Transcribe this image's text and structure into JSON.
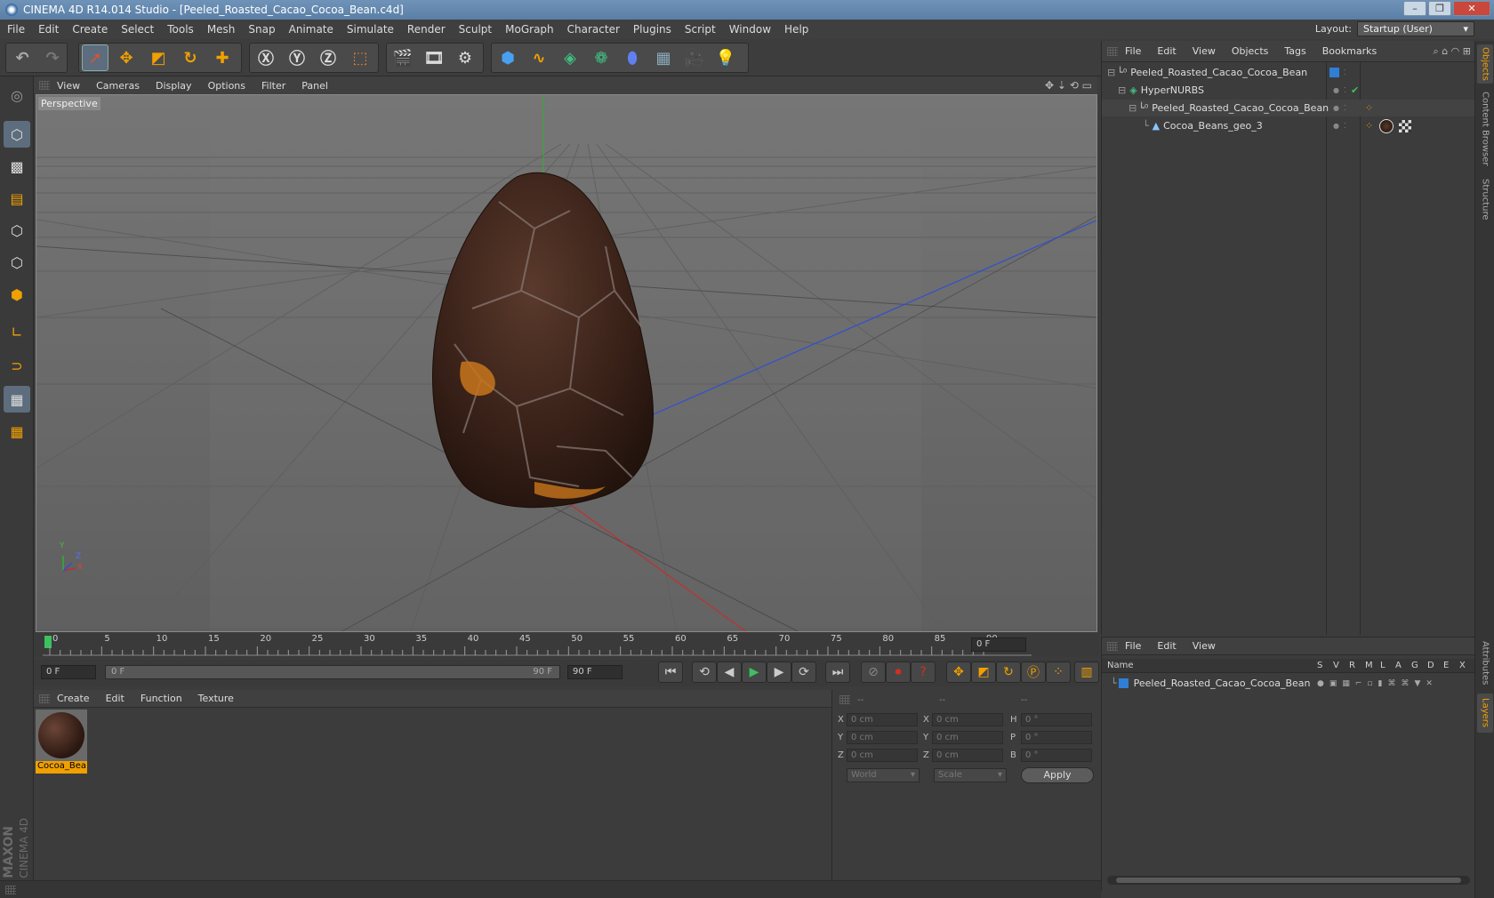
{
  "window": {
    "title": "CINEMA 4D R14.014 Studio - [Peeled_Roasted_Cacao_Cocoa_Bean.c4d]"
  },
  "menubar": {
    "items": [
      "File",
      "Edit",
      "Create",
      "Select",
      "Tools",
      "Mesh",
      "Snap",
      "Animate",
      "Simulate",
      "Render",
      "Sculpt",
      "MoGraph",
      "Character",
      "Plugins",
      "Script",
      "Window",
      "Help"
    ]
  },
  "layout": {
    "label": "Layout:",
    "value": "Startup (User)"
  },
  "viewport": {
    "menu": [
      "View",
      "Cameras",
      "Display",
      "Options",
      "Filter",
      "Panel"
    ],
    "camera_label": "Perspective",
    "axis_labels": {
      "y": "Y",
      "z": "Z",
      "x": "X"
    }
  },
  "timeline": {
    "ticks": [
      "0",
      "5",
      "10",
      "15",
      "20",
      "25",
      "30",
      "35",
      "40",
      "45",
      "50",
      "55",
      "60",
      "65",
      "70",
      "75",
      "80",
      "85",
      "90"
    ],
    "current_frame": "0 F",
    "start_field": "0 F",
    "range_start": "0 F",
    "range_end": "90 F",
    "end_field": "90 F"
  },
  "materials": {
    "menu": [
      "Create",
      "Edit",
      "Function",
      "Texture"
    ],
    "items": [
      {
        "name": "Cocoa_Bea"
      }
    ]
  },
  "coordinates": {
    "headers": [
      "--",
      "--",
      "--"
    ],
    "rows": [
      {
        "axis": "X",
        "pos": "0 cm",
        "axis2": "X",
        "size": "0 cm",
        "rot_axis": "H",
        "rot": "0 °"
      },
      {
        "axis": "Y",
        "pos": "0 cm",
        "axis2": "Y",
        "size": "0 cm",
        "rot_axis": "P",
        "rot": "0 °"
      },
      {
        "axis": "Z",
        "pos": "0 cm",
        "axis2": "Z",
        "size": "0 cm",
        "rot_axis": "B",
        "rot": "0 °"
      }
    ],
    "mode": "World",
    "scale": "Scale",
    "apply": "Apply"
  },
  "objects": {
    "menu": [
      "File",
      "Edit",
      "View",
      "Objects",
      "Tags",
      "Bookmarks"
    ],
    "tree": [
      {
        "name": "Peeled_Roasted_Cacao_Cocoa_Bean",
        "depth": 0
      },
      {
        "name": "HyperNURBS",
        "depth": 1
      },
      {
        "name": "Peeled_Roasted_Cacao_Cocoa_Bean",
        "depth": 2
      },
      {
        "name": "Cocoa_Beans_geo_3",
        "depth": 3
      }
    ]
  },
  "layers": {
    "menu": [
      "File",
      "Edit",
      "View"
    ],
    "header": {
      "name": "Name",
      "cols": [
        "S",
        "V",
        "R",
        "M",
        "L",
        "A",
        "G",
        "D",
        "E",
        "X"
      ]
    },
    "rows": [
      {
        "name": "Peeled_Roasted_Cacao_Cocoa_Bean"
      }
    ]
  },
  "sidetabs": [
    "Objects",
    "Content Browser",
    "Structure",
    "Attributes",
    "Layers"
  ],
  "brand": {
    "line1": "MAXON",
    "line2": "CINEMA 4D"
  },
  "colors": {
    "accent": "#f0a000",
    "layer_blue": "#2f7fd6",
    "axis_x": "#d03030",
    "axis_y": "#30b030",
    "axis_z": "#3050d0"
  }
}
